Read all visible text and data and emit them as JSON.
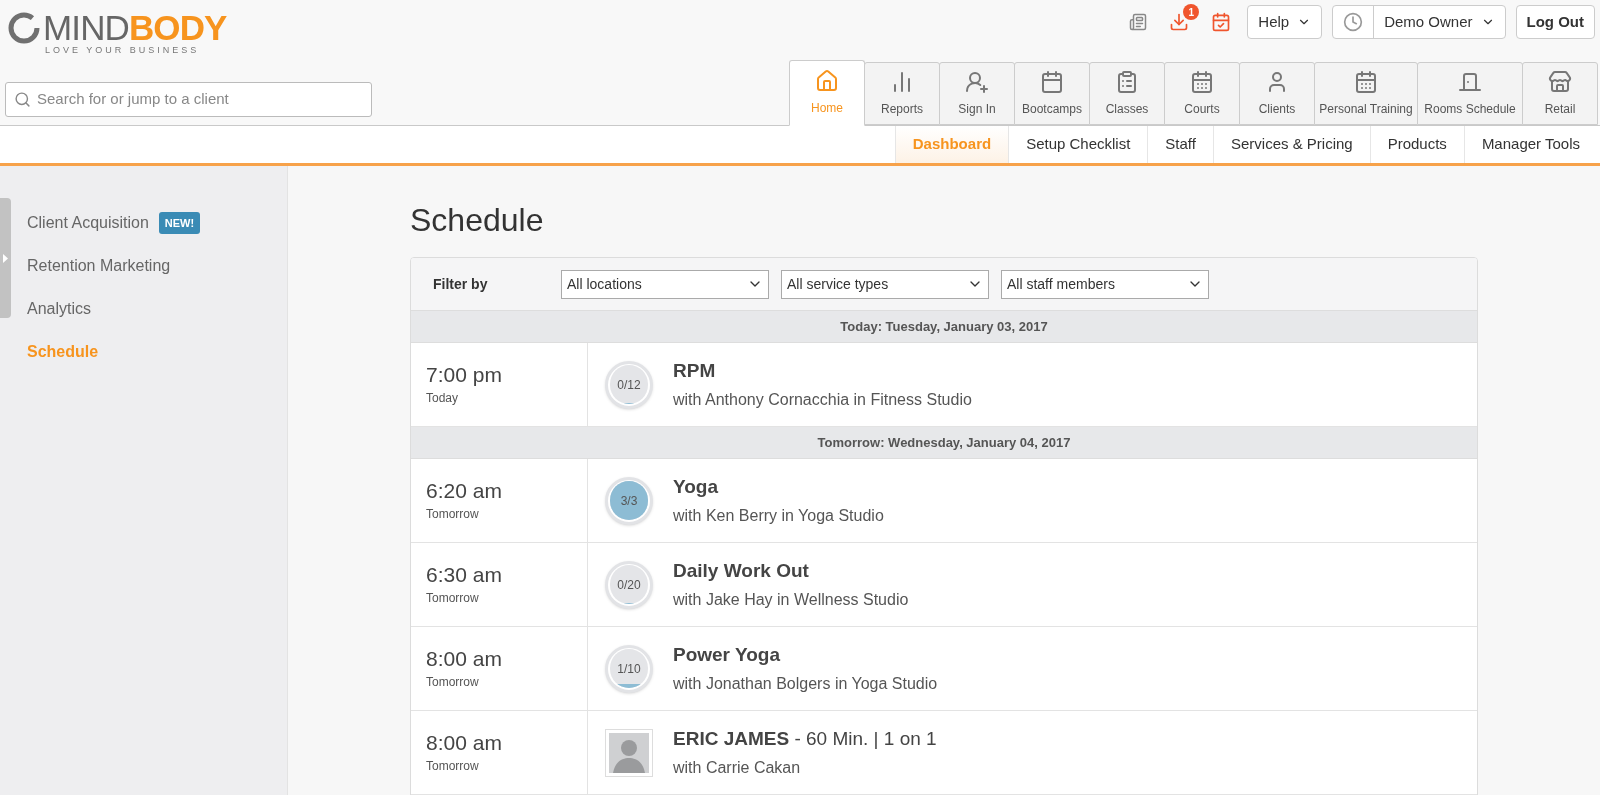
{
  "header": {
    "logo": {
      "word_1": "MIND",
      "word_2": "BODY",
      "tagline": "LOVE YOUR BUSINESS"
    },
    "notifications": {
      "badge": "1"
    },
    "help_menu": "Help",
    "user_menu": "Demo Owner",
    "logout": "Log Out"
  },
  "search": {
    "placeholder": "Search for or jump to a client"
  },
  "tabs": [
    {
      "label": "Home",
      "selected": true
    },
    {
      "label": "Reports",
      "selected": false
    },
    {
      "label": "Sign In",
      "selected": false
    },
    {
      "label": "Bootcamps",
      "selected": false
    },
    {
      "label": "Classes",
      "selected": false
    },
    {
      "label": "Courts",
      "selected": false
    },
    {
      "label": "Clients",
      "selected": false
    },
    {
      "label": "Personal Training",
      "selected": false
    },
    {
      "label": "Rooms Schedule",
      "selected": false
    },
    {
      "label": "Retail",
      "selected": false
    }
  ],
  "subnav": [
    {
      "label": "Dashboard",
      "selected": true
    },
    {
      "label": "Setup Checklist",
      "selected": false
    },
    {
      "label": "Staff",
      "selected": false
    },
    {
      "label": "Services & Pricing",
      "selected": false
    },
    {
      "label": "Products",
      "selected": false
    },
    {
      "label": "Manager Tools",
      "selected": false
    }
  ],
  "sidebar": {
    "items": [
      {
        "label": "Client Acquisition",
        "badge": "NEW!",
        "selected": false
      },
      {
        "label": "Retention Marketing",
        "selected": false
      },
      {
        "label": "Analytics",
        "selected": false
      },
      {
        "label": "Schedule",
        "selected": true
      }
    ]
  },
  "page_title": "Schedule",
  "filters": {
    "label": "Filter by",
    "selects": [
      {
        "value": "All locations"
      },
      {
        "value": "All service types"
      },
      {
        "value": "All staff members"
      }
    ]
  },
  "schedule": [
    {
      "date": "Today: Tuesday, January 03, 2017",
      "rows": [
        {
          "kind": "class",
          "time": "7:00 pm",
          "day": "Today",
          "capacity": "0/12",
          "level": 0,
          "title": "RPM",
          "detail": "with Anthony Cornacchia in Fitness Studio"
        }
      ]
    },
    {
      "date": "Tomorrow: Wednesday, January 04, 2017",
      "rows": [
        {
          "kind": "class",
          "time": "6:20 am",
          "day": "Tomorrow",
          "capacity": "3/3",
          "level": 1,
          "title": "Yoga",
          "detail": "with Ken Berry in Yoga Studio"
        },
        {
          "kind": "class",
          "time": "6:30 am",
          "day": "Tomorrow",
          "capacity": "0/20",
          "level": 0,
          "title": "Daily Work Out",
          "detail": "with Jake Hay in Wellness Studio"
        },
        {
          "kind": "class",
          "time": "8:00 am",
          "day": "Tomorrow",
          "capacity": "1/10",
          "level": 0.1,
          "title": "Power Yoga",
          "detail": "with Jonathan Bolgers in Yoga Studio"
        },
        {
          "kind": "appointment",
          "time": "8:00 am",
          "day": "Tomorrow",
          "title": "**ERIC JAMES** - 60 Min. | 1 on 1",
          "detail": "with Carrie Cakan"
        }
      ]
    }
  ]
}
